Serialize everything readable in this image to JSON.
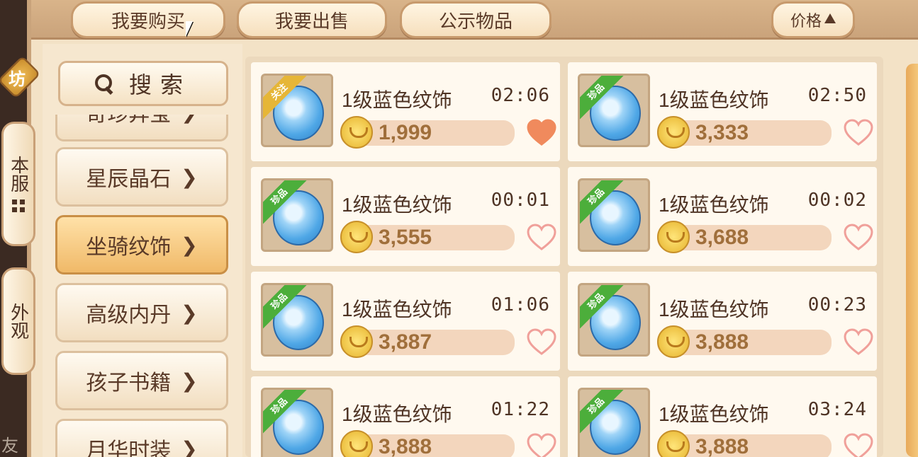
{
  "top_tabs": {
    "buy": "我要购买",
    "sell": "我要出售",
    "public": "公示物品",
    "sort_price": "价格"
  },
  "side_tabs": {
    "emblem": "坊",
    "server": "本服",
    "outer": "外观",
    "friend": "友"
  },
  "search": {
    "label": "搜索"
  },
  "categories": [
    {
      "label": "奇珍异宝",
      "active": false
    },
    {
      "label": "星辰晶石",
      "active": false
    },
    {
      "label": "坐骑纹饰",
      "active": true
    },
    {
      "label": "高级内丹",
      "active": false
    },
    {
      "label": "孩子书籍",
      "active": false
    },
    {
      "label": "月华时装",
      "active": false
    }
  ],
  "listings": [
    {
      "name": "1级蓝色纹饰",
      "time": "02:06",
      "price": "1,999",
      "ribbon": "关注",
      "ribbon_type": "follow",
      "favorited": true
    },
    {
      "name": "1级蓝色纹饰",
      "time": "02:50",
      "price": "3,333",
      "ribbon": "珍品",
      "ribbon_type": "rare",
      "favorited": false
    },
    {
      "name": "1级蓝色纹饰",
      "time": "00:01",
      "price": "3,555",
      "ribbon": "珍品",
      "ribbon_type": "rare",
      "favorited": false
    },
    {
      "name": "1级蓝色纹饰",
      "time": "00:02",
      "price": "3,688",
      "ribbon": "珍品",
      "ribbon_type": "rare",
      "favorited": false
    },
    {
      "name": "1级蓝色纹饰",
      "time": "01:06",
      "price": "3,887",
      "ribbon": "珍品",
      "ribbon_type": "rare",
      "favorited": false
    },
    {
      "name": "1级蓝色纹饰",
      "time": "00:23",
      "price": "3,888",
      "ribbon": "珍品",
      "ribbon_type": "rare",
      "favorited": false
    },
    {
      "name": "1级蓝色纹饰",
      "time": "01:22",
      "price": "3,888",
      "ribbon": "珍品",
      "ribbon_type": "rare",
      "favorited": false
    },
    {
      "name": "1级蓝色纹饰",
      "time": "03:24",
      "price": "3,888",
      "ribbon": "珍品",
      "ribbon_type": "rare",
      "favorited": false
    }
  ],
  "colors": {
    "heart_filled": "#f08a5d",
    "heart_outline": "#f0a09a",
    "accent": "#f0b968"
  }
}
